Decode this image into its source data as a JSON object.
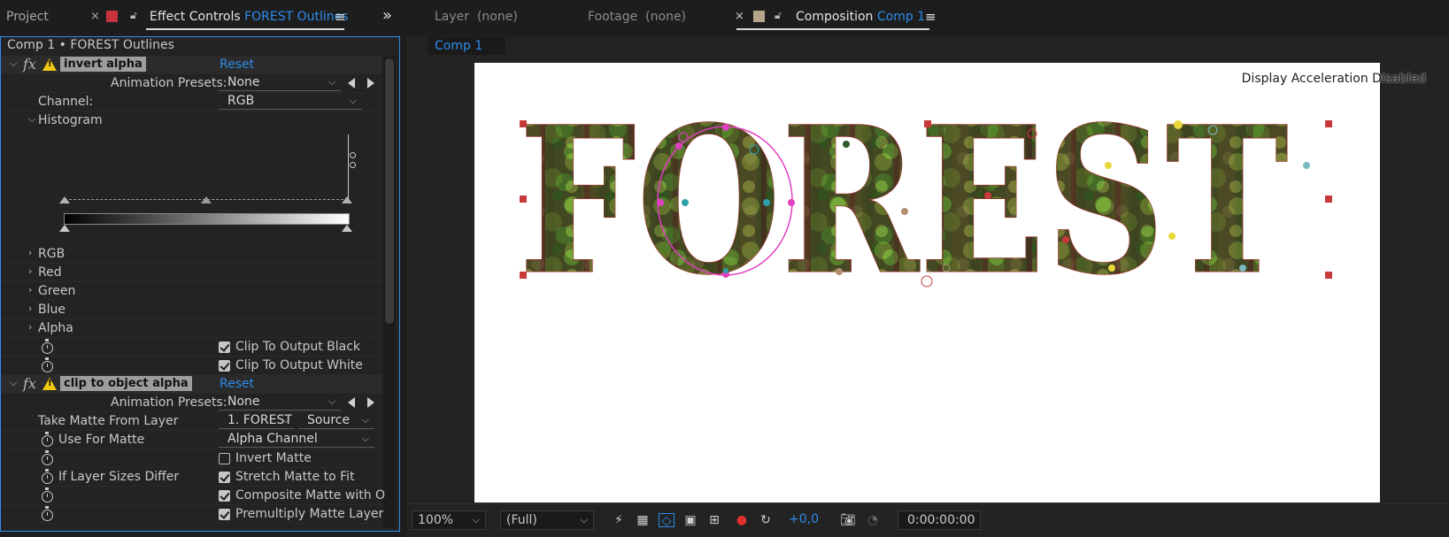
{
  "left_tabs": {
    "project": "Project",
    "effect_controls_prefix": "Effect Controls",
    "effect_controls_layer": "FOREST Outlines",
    "close": "×",
    "menu": "≡",
    "overflow": "»"
  },
  "breadcrumb": "Comp 1 • FOREST Outlines",
  "effect1": {
    "name": "invert alpha",
    "reset": "Reset",
    "presets_label": "Animation Presets:",
    "presets_value": "None",
    "channel_label": "Channel:",
    "channel_value": "RGB",
    "histogram_label": "Histogram",
    "channels": [
      "RGB",
      "Red",
      "Green",
      "Blue",
      "Alpha"
    ],
    "clip_black": "Clip To Output Black",
    "clip_white": "Clip To Output White"
  },
  "effect2": {
    "name": "clip to object alpha",
    "reset": "Reset",
    "presets_label": "Animation Presets:",
    "presets_value": "None",
    "matte_layer_label": "Take Matte From Layer",
    "matte_layer_value": "1. FOREST",
    "matte_source_value": "Source",
    "use_for_matte_label": "Use For Matte",
    "use_for_matte_value": "Alpha Channel",
    "invert_matte": "Invert Matte",
    "sizes_differ_label": "If Layer Sizes Differ",
    "stretch": "Stretch Matte to Fit",
    "composite": "Composite Matte with O",
    "premultiply": "Premultiply Matte Layer"
  },
  "right_tabs": {
    "layer": "Layer",
    "layer_value": "(none)",
    "footage": "Footage",
    "footage_value": "(none)",
    "close": "×",
    "composition": "Composition",
    "comp_name": "Comp 1",
    "menu": "≡"
  },
  "comp_subtab": "Comp 1",
  "display_accel": "Display Acceleration Disabled",
  "canvas_word": "FOREST",
  "bottom": {
    "zoom": "100%",
    "resolution": "(Full)",
    "exposure": "+0,0",
    "timecode": "0:00:00:00"
  }
}
